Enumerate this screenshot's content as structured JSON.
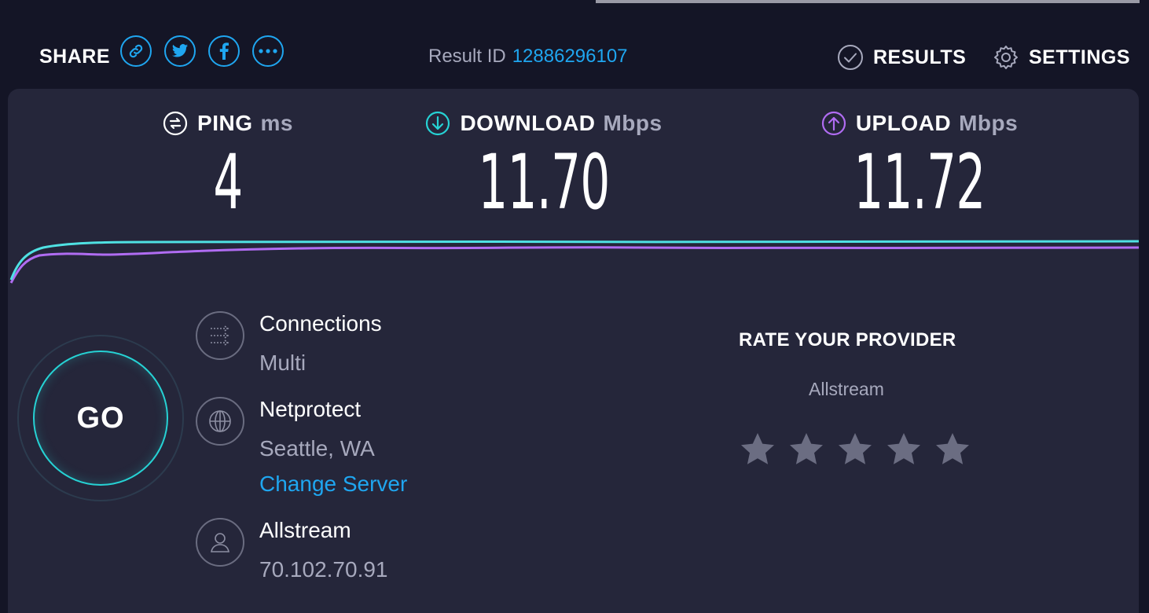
{
  "header": {
    "share_label": "SHARE",
    "share_icons": [
      "link-icon",
      "twitter-icon",
      "facebook-icon",
      "more-icon"
    ],
    "result_id_label": "Result ID",
    "result_id": "12886296107",
    "results_label": "RESULTS",
    "settings_label": "SETTINGS"
  },
  "metrics": {
    "ping": {
      "label": "PING",
      "unit": "ms",
      "value": "4"
    },
    "download": {
      "label": "DOWNLOAD",
      "unit": "Mbps",
      "value": "11.70"
    },
    "upload": {
      "label": "UPLOAD",
      "unit": "Mbps",
      "value": "11.72"
    }
  },
  "go_label": "GO",
  "info": {
    "connections": {
      "title": "Connections",
      "value": "Multi"
    },
    "server": {
      "title": "Netprotect",
      "location": "Seattle, WA",
      "change_link": "Change Server"
    },
    "provider": {
      "title": "Allstream",
      "ip": "70.102.70.91"
    }
  },
  "rate": {
    "title": "RATE YOUR PROVIDER",
    "provider": "Allstream",
    "stars_total": 5,
    "stars_selected": 0
  },
  "colors": {
    "accent_blue": "#1fa6f0",
    "download_cyan": "#26d2d4",
    "upload_purple": "#b06cf2",
    "background": "#141526",
    "panel": "#25263a"
  }
}
